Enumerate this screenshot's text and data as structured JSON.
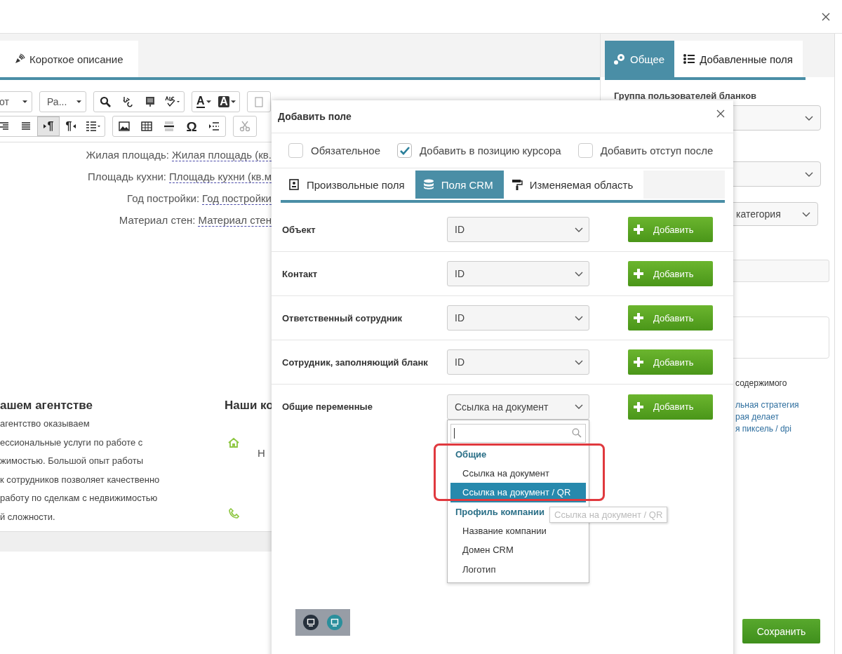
{
  "editor": {
    "tabs": [
      {
        "label": "Короткое описание",
        "selected": true
      }
    ],
    "toolbar": [
      [
        [
          {
            "kind": "select",
            "text": "от"
          }
        ],
        [
          {
            "kind": "select",
            "text": "Ра..."
          }
        ],
        [
          {
            "kind": "search",
            "pressed": false
          },
          {
            "kind": "replace",
            "pressed": false
          },
          {
            "kind": "template",
            "pressed": false
          },
          {
            "kind": "spell",
            "pressed": false
          }
        ],
        [
          {
            "kind": "text-color",
            "text": "A",
            "pressed": false
          },
          {
            "kind": "text-bg",
            "text": "A",
            "pressed": false
          }
        ],
        [
          {
            "kind": "paste",
            "pressed": false
          }
        ]
      ],
      [
        [
          {
            "kind": "align-right",
            "pressed": false
          },
          {
            "kind": "justify",
            "pressed": false
          },
          {
            "kind": "ltr",
            "text": "¶",
            "pressed": true
          },
          {
            "kind": "rtl",
            "text": "¶",
            "pressed": false
          },
          {
            "kind": "list-style",
            "pressed": false
          }
        ],
        [
          {
            "kind": "image",
            "pressed": false
          },
          {
            "kind": "table",
            "pressed": false
          },
          {
            "kind": "hr",
            "pressed": false
          },
          {
            "kind": "glyph",
            "text": "Ω",
            "pressed": false
          },
          {
            "kind": "pagebreak",
            "pressed": false
          }
        ],
        [
          {
            "kind": "cut",
            "pressed": false
          }
        ]
      ]
    ],
    "fields": [
      {
        "label": "Жилая площадь:",
        "value": "Жилая площадь (кв."
      },
      {
        "label": "Площадь кухни:",
        "value": "Площадь кухни (кв.м"
      },
      {
        "label": "Год постройки:",
        "value": "Год постройки"
      },
      {
        "label": "Материал стен:",
        "value": "Материал стен"
      }
    ],
    "about": {
      "heading": "ашем агентстве",
      "lines": [
        "агентство оказываем",
        "ессиональные услуги по работе с",
        "жимостью. Большой опыт работы",
        "к сотрудников позволяет качественно",
        "работу по сделкам с недвижимостью",
        "й сложности."
      ]
    },
    "contacts": {
      "heading": "Наши ко",
      "letter": "Н"
    }
  },
  "settings": {
    "tabs": [
      {
        "label": "Общее",
        "selected": true
      },
      {
        "label": "Добавленные поля",
        "selected": false
      }
    ],
    "group_label": "Группа пользователей бланков",
    "category_value": "категория",
    "content_label": "содержимого",
    "note_lines": [
      "льная стратегия",
      "рая делает",
      "я пиксель / dpi"
    ],
    "save": "Сохранить"
  },
  "dialog": {
    "title": "Добавить поле",
    "options": [
      {
        "label": "Обязательное",
        "checked": false
      },
      {
        "label": "Добавить в позицию курсора",
        "checked": true
      },
      {
        "label": "Добавить отступ после",
        "checked": false
      }
    ],
    "tabs": [
      {
        "label": "Произвольные поля",
        "selected": false
      },
      {
        "label": "Поля CRM",
        "selected": true
      },
      {
        "label": "Изменяемая область",
        "selected": false
      }
    ],
    "rows": [
      {
        "label": "Объект",
        "value": "ID",
        "button": "Добавить"
      },
      {
        "label": "Контакт",
        "value": "ID",
        "button": "Добавить"
      },
      {
        "label": "Ответственный сотрудник",
        "value": "ID",
        "button": "Добавить"
      },
      {
        "label": "Сотрудник, заполняющий бланк",
        "value": "ID",
        "button": "Добавить"
      },
      {
        "label": "Общие переменные",
        "value": "Ссылка на документ",
        "button": "Добавить",
        "dropdown": {
          "groups": [
            {
              "label": "Общие",
              "items": [
                {
                  "label": "Ссылка на документ",
                  "selected": false
                },
                {
                  "label": "Ссылка на документ / QR",
                  "selected": true
                }
              ]
            },
            {
              "label": "Профиль компании",
              "items": [
                {
                  "label": "Название компании",
                  "selected": false
                },
                {
                  "label": "Домен CRM",
                  "selected": false
                },
                {
                  "label": "Логотип",
                  "selected": false
                }
              ]
            }
          ]
        }
      }
    ],
    "tooltip": "Ссылка на документ / QR",
    "view_buttons": [
      {
        "selected": false
      },
      {
        "selected": true
      }
    ]
  }
}
